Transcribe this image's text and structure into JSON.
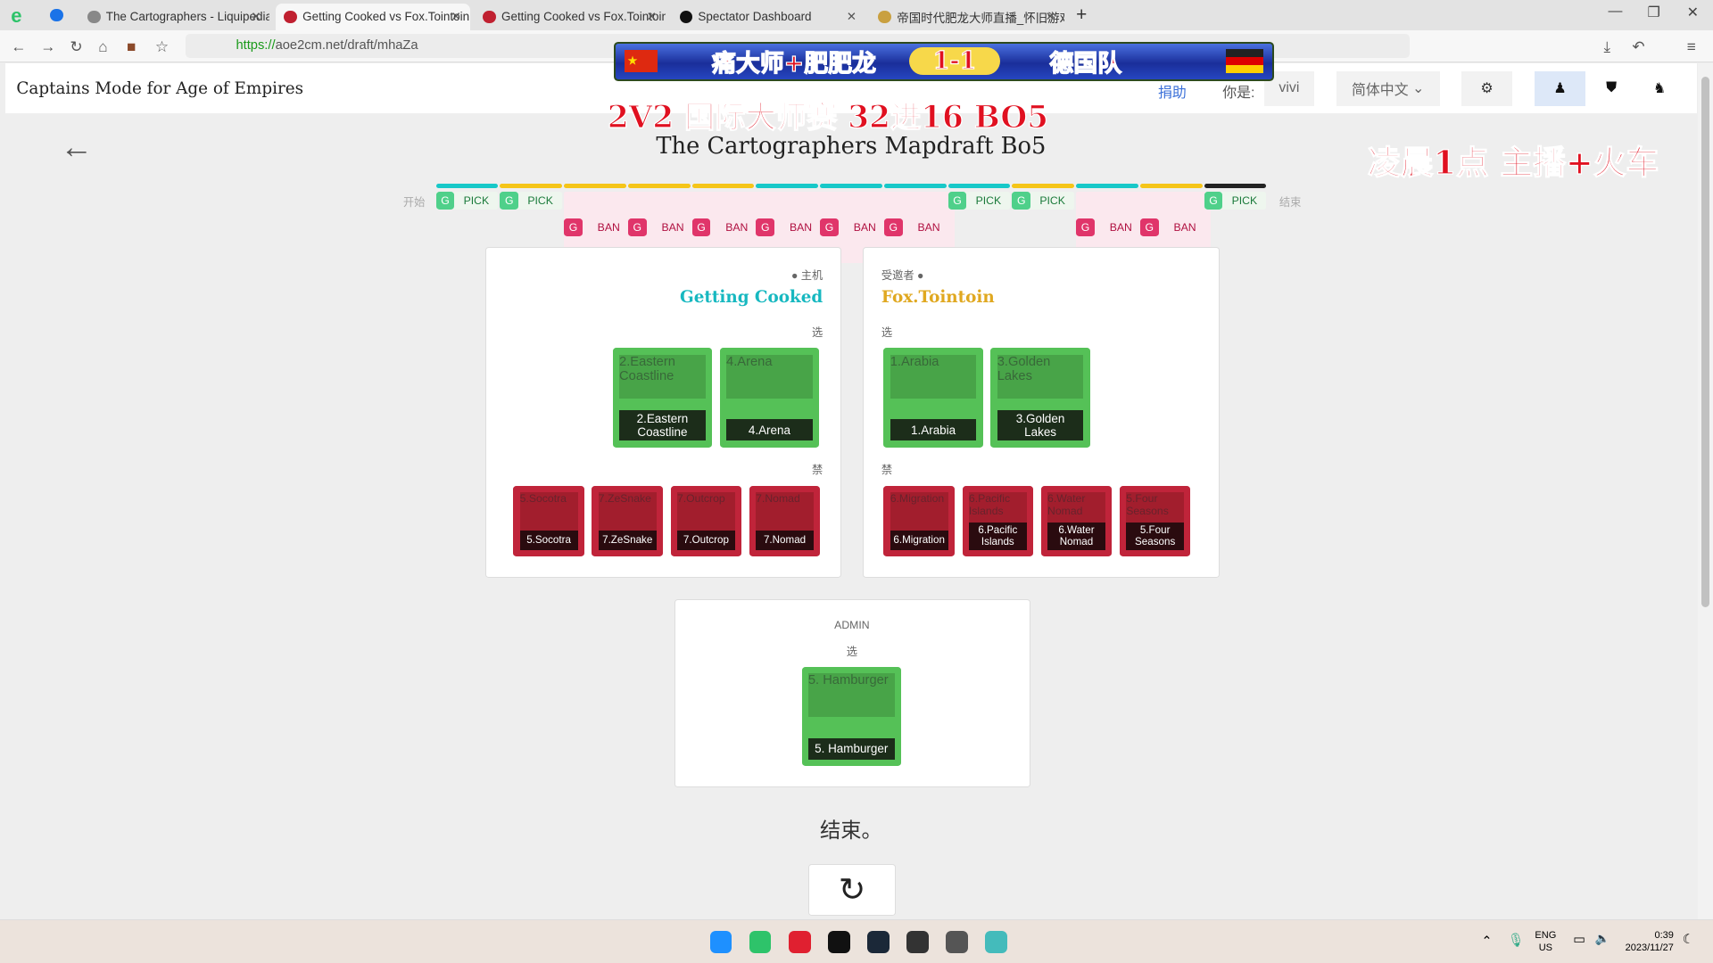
{
  "browser": {
    "tabs": [
      {
        "title": "The Cartographers - Liquipedia",
        "active": false
      },
      {
        "title": "Getting Cooked vs Fox.Tointoin",
        "active": true
      },
      {
        "title": "Getting Cooked vs Fox.Tointoin",
        "active": false
      },
      {
        "title": "Spectator Dashboard",
        "active": false
      },
      {
        "title": "帝国时代肥龙大师直播_怀旧游戏",
        "active": false
      }
    ],
    "url_scheme": "https://",
    "url_rest": "aoe2cm.net/draft/mhaZa"
  },
  "header": {
    "site_title": "Captains Mode for Age of Empires",
    "donate": "捐助",
    "you_are": "你是:",
    "username": "vivi",
    "language": "简体中文"
  },
  "overlay": {
    "banner_left": "痛大师+肥肥龙",
    "score": "1-1",
    "banner_right": "德国队",
    "event": "2V2  国际大师赛   32进16  BO5",
    "schedule": "凌晨1点  主播+火车"
  },
  "draft": {
    "title": "The Cartographers Mapdraft Bo5",
    "start_label": "开始",
    "end_label": "结束",
    "timeline": [
      {
        "player": "G",
        "action": "PICK",
        "color": "#17c8c8"
      },
      {
        "player": "G",
        "action": "PICK",
        "color": "#f5c518"
      },
      {
        "player": "G",
        "action": "BAN",
        "color": "#f5c518"
      },
      {
        "player": "G",
        "action": "BAN",
        "color": "#f5c518"
      },
      {
        "player": "G",
        "action": "BAN",
        "color": "#f5c518"
      },
      {
        "player": "G",
        "action": "BAN",
        "color": "#17c8c8"
      },
      {
        "player": "G",
        "action": "BAN",
        "color": "#17c8c8"
      },
      {
        "player": "G",
        "action": "BAN",
        "color": "#17c8c8"
      },
      {
        "player": "G",
        "action": "PICK",
        "color": "#17c8c8"
      },
      {
        "player": "G",
        "action": "PICK",
        "color": "#f5c518"
      },
      {
        "player": "G",
        "action": "BAN",
        "color": "#17c8c8"
      },
      {
        "player": "G",
        "action": "BAN",
        "color": "#f5c518"
      },
      {
        "player": "G",
        "action": "PICK",
        "color": "#222222"
      }
    ],
    "host": {
      "role": "主机",
      "name": "Getting Cooked",
      "color": "#17b8c0",
      "pick_label": "选",
      "ban_label": "禁",
      "picks": [
        {
          "alt": "2.Eastern Coastline",
          "name": "2.Eastern Coastline"
        },
        {
          "alt": "4.Arena",
          "name": "4.Arena"
        }
      ],
      "bans": [
        {
          "alt": "5.Socotra",
          "name": "5.Socotra"
        },
        {
          "alt": "7.ZeSnake",
          "name": "7.ZeSnake"
        },
        {
          "alt": "7.Outcrop",
          "name": "7.Outcrop"
        },
        {
          "alt": "7.Nomad",
          "name": "7.Nomad"
        }
      ]
    },
    "guest": {
      "role": "受邀者",
      "name": "Fox.Tointoin",
      "color": "#e0a820",
      "pick_label": "选",
      "ban_label": "禁",
      "picks": [
        {
          "alt": "1.Arabia",
          "name": "1.Arabia"
        },
        {
          "alt": "3.Golden Lakes",
          "name": "3.Golden Lakes"
        }
      ],
      "bans": [
        {
          "alt": "6.Migration",
          "name": "6.Migration"
        },
        {
          "alt": "6.Pacific Islands",
          "name": "6.Pacific Islands"
        },
        {
          "alt": "6.Water Nomad",
          "name": "6.Water Nomad"
        },
        {
          "alt": "5.Four Seasons",
          "name": "5.Four Seasons"
        }
      ]
    },
    "admin": {
      "label": "ADMIN",
      "pick_label": "选",
      "picks": [
        {
          "alt": "5. Hamburger",
          "name": "5. Hamburger"
        }
      ]
    },
    "finished": "结束。"
  },
  "taskbar": {
    "lang1": "ENG",
    "lang2": "US",
    "time": "0:39",
    "date": "2023/11/27"
  },
  "colors": {
    "pick_tile": "#55c157",
    "ban_tile": "#c0243a",
    "pick_chip": "#4fd08a",
    "ban_chip": "#e0356a"
  }
}
